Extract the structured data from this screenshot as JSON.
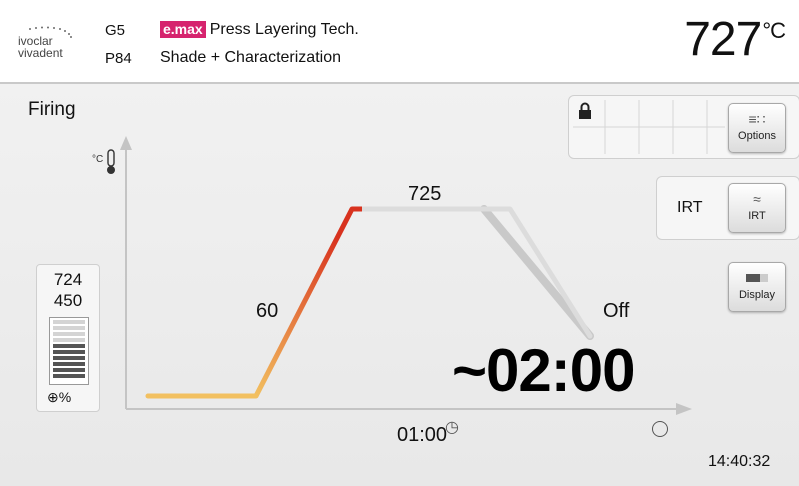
{
  "header": {
    "logo_text_1": "ivoclar",
    "logo_text_2": "vivadent",
    "program_group": "G5",
    "program_number": "P84",
    "material_badge": "e.max",
    "program_name": "Press Layering Tech.",
    "program_subtitle": "Shade + Characterization",
    "temperature": "727",
    "temperature_unit": "°C"
  },
  "screen": {
    "title": "Firing"
  },
  "toolbar": {
    "options_label": "Options",
    "irt_status": "IRT",
    "irt_label": "IRT",
    "display_label": "Display"
  },
  "stand": {
    "value_top": "724",
    "value_bottom": "450",
    "unit": "%",
    "level_fraction": 0.55
  },
  "curve": {
    "rate_label": "60",
    "hold_temp_label": "725",
    "cooling_label": "Off",
    "hold_time_label": "01:00",
    "remaining_time": "~02:00",
    "progress_fraction": 0.25
  },
  "status": {
    "clock": "14:40:32"
  },
  "colors": {
    "brand": "#d6246e",
    "heating_start": "#f2c060",
    "heating_end": "#d8321e",
    "pending_curve": "#cfcfcf"
  }
}
